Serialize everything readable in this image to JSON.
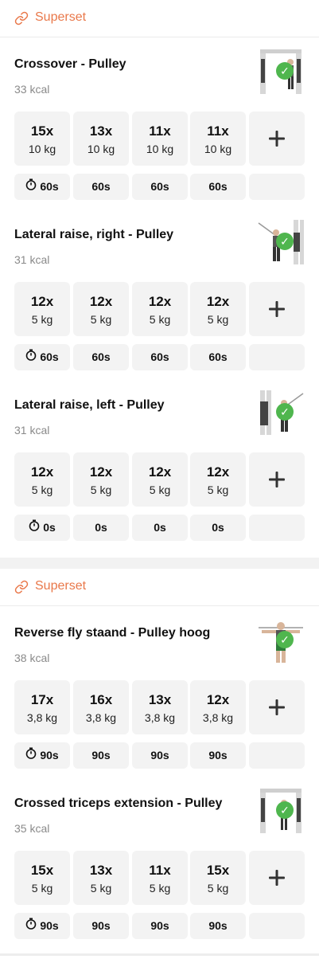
{
  "groups": [
    {
      "label": "Superset",
      "exercises": [
        {
          "title": "Crossover - Pulley",
          "kcal": "33 kcal",
          "thumb": "cable-crossover-machine",
          "sets": [
            {
              "reps": "15x",
              "weight": "10 kg"
            },
            {
              "reps": "13x",
              "weight": "10 kg"
            },
            {
              "reps": "11x",
              "weight": "10 kg"
            },
            {
              "reps": "11x",
              "weight": "10 kg"
            }
          ],
          "rests": [
            "60s",
            "60s",
            "60s",
            "60s"
          ]
        },
        {
          "title": "Lateral raise, right - Pulley",
          "kcal": "31 kcal",
          "thumb": "lateral-raise-right",
          "sets": [
            {
              "reps": "12x",
              "weight": "5 kg"
            },
            {
              "reps": "12x",
              "weight": "5 kg"
            },
            {
              "reps": "12x",
              "weight": "5 kg"
            },
            {
              "reps": "12x",
              "weight": "5 kg"
            }
          ],
          "rests": [
            "60s",
            "60s",
            "60s",
            "60s"
          ]
        },
        {
          "title": "Lateral raise, left - Pulley",
          "kcal": "31 kcal",
          "thumb": "lateral-raise-left",
          "sets": [
            {
              "reps": "12x",
              "weight": "5 kg"
            },
            {
              "reps": "12x",
              "weight": "5 kg"
            },
            {
              "reps": "12x",
              "weight": "5 kg"
            },
            {
              "reps": "12x",
              "weight": "5 kg"
            }
          ],
          "rests": [
            "0s",
            "0s",
            "0s",
            "0s"
          ]
        }
      ]
    },
    {
      "label": "Superset",
      "exercises": [
        {
          "title": "Reverse fly staand - Pulley hoog",
          "kcal": "38 kcal",
          "thumb": "reverse-fly",
          "sets": [
            {
              "reps": "17x",
              "weight": "3,8 kg"
            },
            {
              "reps": "16x",
              "weight": "3,8 kg"
            },
            {
              "reps": "13x",
              "weight": "3,8 kg"
            },
            {
              "reps": "12x",
              "weight": "3,8 kg"
            }
          ],
          "rests": [
            "90s",
            "90s",
            "90s",
            "90s"
          ]
        },
        {
          "title": "Crossed triceps extension - Pulley",
          "kcal": "35 kcal",
          "thumb": "triceps-extension",
          "sets": [
            {
              "reps": "15x",
              "weight": "5 kg"
            },
            {
              "reps": "13x",
              "weight": "5 kg"
            },
            {
              "reps": "11x",
              "weight": "5 kg"
            },
            {
              "reps": "15x",
              "weight": "5 kg"
            }
          ],
          "rests": [
            "90s",
            "90s",
            "90s",
            "90s"
          ]
        }
      ]
    }
  ],
  "colors": {
    "accent": "#e9784a",
    "check": "#4fb64e",
    "cell": "#f3f3f3"
  },
  "icons": {
    "group": "link-icon",
    "add": "plus-icon",
    "rest": "timer-icon",
    "done": "checkmark-icon"
  }
}
